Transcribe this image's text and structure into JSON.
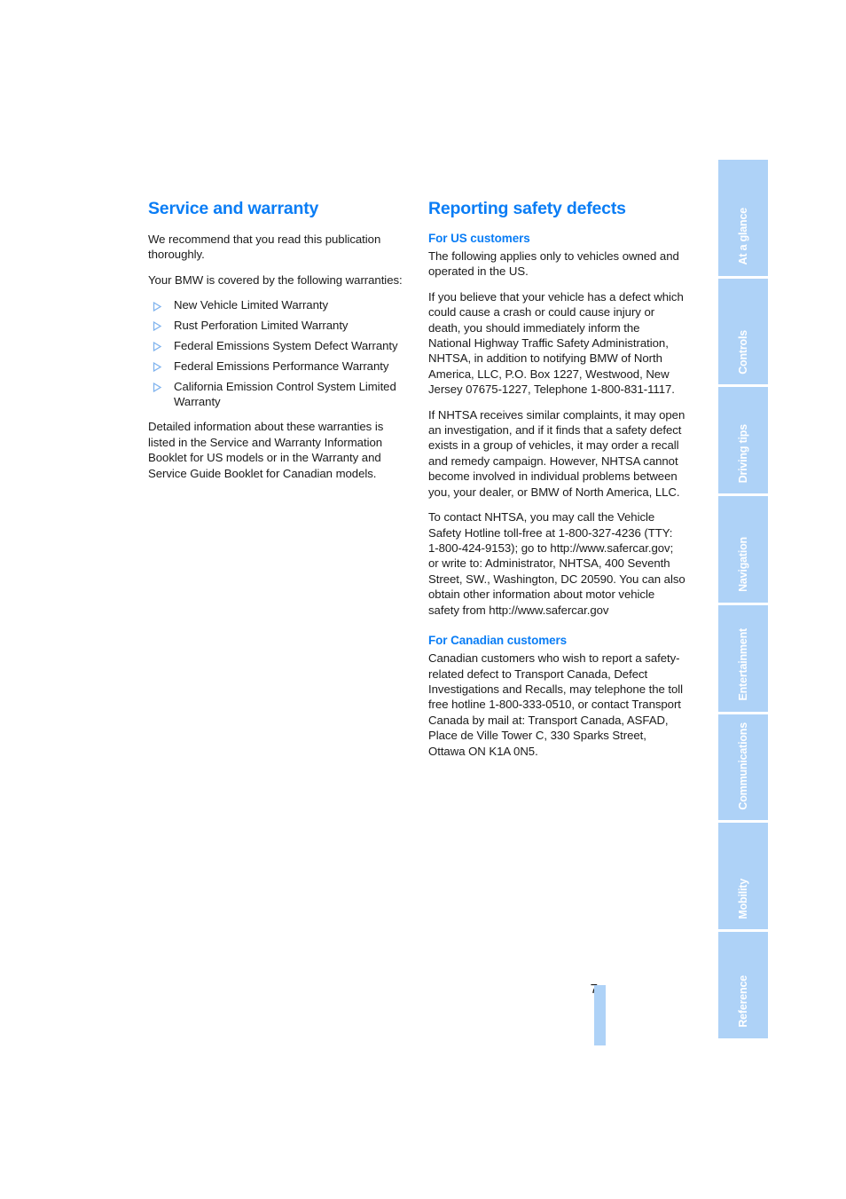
{
  "document": {
    "page_number": "7"
  },
  "left_column": {
    "heading": "Service and warranty",
    "intro_1": "We recommend that you read this publication thoroughly.",
    "intro_2": "Your BMW is covered by the following warranties:",
    "warranties": [
      "New Vehicle Limited Warranty",
      "Rust Perforation Limited Warranty",
      "Federal Emissions System Defect Warranty",
      "Federal Emissions Performance Warranty",
      "California Emission Control System Limited Warranty"
    ],
    "closing": "Detailed information about these warranties is listed in the Service and Warranty Information Booklet for US models or in the Warranty and Service Guide Booklet for Canadian models."
  },
  "right_column": {
    "heading": "Reporting safety defects",
    "us_section": {
      "subheading": "For US customers",
      "paragraph_1": "The following applies only to vehicles owned and operated in the US.",
      "paragraph_2": "If you believe that your vehicle has a defect which could cause a crash or could cause injury or death, you should immediately inform the National Highway Traffic Safety Administration, NHTSA, in addition to notifying BMW of North America, LLC, P.O. Box 1227, Westwood, New Jersey 07675-1227, Telephone 1-800-831-1117.",
      "paragraph_3": "If NHTSA receives similar complaints, it may open an investigation, and if it finds that a safety defect exists in a group of vehicles, it may order a recall and remedy campaign. However, NHTSA cannot become involved in individual problems between you, your dealer, or BMW of North America, LLC.",
      "paragraph_4": "To contact NHTSA, you may call the Vehicle Safety Hotline toll-free at 1-800-327-4236 (TTY: 1-800-424-9153); go to http://www.safercar.gov; or write to: Administrator, NHTSA, 400 Seventh Street, SW., Washington, DC 20590. You can also obtain other information about motor vehicle safety from http://www.safercar.gov"
    },
    "canadian_section": {
      "subheading": "For Canadian customers",
      "paragraph_1": "Canadian customers who wish to report a safety-related defect to Transport Canada, Defect Investigations and Recalls, may telephone the toll free hotline 1-800-333-0510, or contact Transport Canada by mail at: Transport Canada, ASFAD, Place de Ville Tower C, 330 Sparks Street, Ottawa ON K1A 0N5."
    }
  },
  "tabs": [
    {
      "label": "At a glance"
    },
    {
      "label": "Controls"
    },
    {
      "label": "Driving tips"
    },
    {
      "label": "Navigation"
    },
    {
      "label": "Entertainment"
    },
    {
      "label": "Communications"
    },
    {
      "label": "Mobility"
    },
    {
      "label": "Reference"
    }
  ],
  "colors": {
    "heading_blue": "#0a7df5",
    "tab_blue": "#aed2f7",
    "bullet_blue": "#7fb3ee",
    "body_text": "#1a1a1a"
  }
}
